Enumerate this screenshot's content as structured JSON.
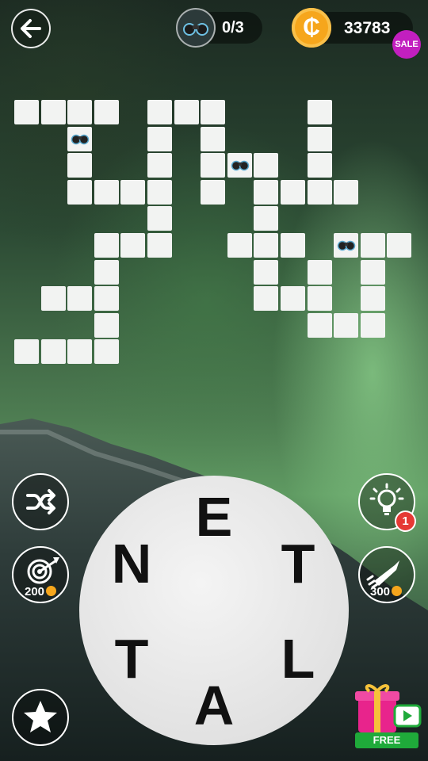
{
  "header": {
    "back_icon": "arrow-left-icon",
    "bonus_icon": "binoculars-icon",
    "bonus_progress": "0/3",
    "coin_icon": "coin-icon",
    "coins": "33783",
    "sale_badge": "SALE"
  },
  "board": {
    "empty_cell_color": "#f2f3f2",
    "hint_icon": "binoculars-icon"
  },
  "controls": {
    "shuffle_icon": "shuffle-icon",
    "target_icon": "target-dart-icon",
    "target_cost": "200",
    "hint_icon": "lightbulb-icon",
    "hint_badge": "1",
    "rocket_icon": "rocket-icon",
    "rocket_cost": "300",
    "star_icon": "star-icon",
    "gift_icon": "gift-video-icon",
    "gift_label": "FREE"
  },
  "wheel": {
    "letters": [
      "E",
      "T",
      "L",
      "A",
      "T",
      "N"
    ]
  },
  "colors": {
    "coin": "#f6a61c",
    "sale": "#c21fbf",
    "badge": "#e53935",
    "free_banner": "#1faa3a",
    "gift": "#e8248c"
  }
}
